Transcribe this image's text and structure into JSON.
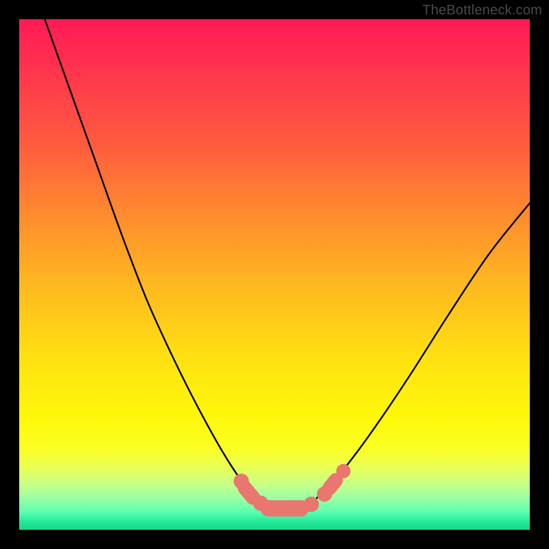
{
  "watermark": {
    "text": "TheBottleneck.com"
  },
  "chart_data": {
    "type": "line",
    "title": "",
    "xlabel": "",
    "ylabel": "",
    "xlim": [
      0,
      100
    ],
    "ylim": [
      0,
      100
    ],
    "grid": false,
    "legend": false,
    "series": [
      {
        "name": "curve",
        "color": "#000000",
        "x": [
          5,
          10,
          15,
          20,
          25,
          30,
          35,
          40,
          44,
          47,
          49,
          51,
          54,
          57,
          59,
          62,
          66,
          71,
          77,
          84,
          92,
          100
        ],
        "values": [
          100,
          86,
          72,
          58,
          45,
          34,
          24,
          15,
          9,
          6,
          4,
          4,
          4,
          5,
          7,
          10,
          15,
          22,
          31,
          42,
          54,
          64
        ]
      }
    ],
    "markers": [
      {
        "kind": "dot",
        "x": 43.5,
        "y": 9.5,
        "r": 1.5
      },
      {
        "kind": "pill",
        "x1": 44.2,
        "y1": 8.2,
        "x2": 45.8,
        "y2": 6.3,
        "r": 1.4
      },
      {
        "kind": "dot",
        "x": 47.3,
        "y": 5.2,
        "r": 1.5
      },
      {
        "kind": "pill",
        "x1": 48.8,
        "y1": 4.2,
        "x2": 55.2,
        "y2": 4.2,
        "r": 1.6
      },
      {
        "kind": "dot",
        "x": 57.2,
        "y": 5.0,
        "r": 1.5
      },
      {
        "kind": "dot",
        "x": 59.8,
        "y": 7.0,
        "r": 1.5
      },
      {
        "kind": "pill",
        "x1": 60.8,
        "y1": 8.2,
        "x2": 62.0,
        "y2": 9.7,
        "r": 1.4
      },
      {
        "kind": "dot",
        "x": 63.5,
        "y": 11.5,
        "r": 1.4
      }
    ],
    "marker_color": "#e9766f",
    "background_gradient": [
      "#ff1a55",
      "#ff8a2f",
      "#ffe012",
      "#fbff23",
      "#5cffb0",
      "#18d884"
    ]
  }
}
